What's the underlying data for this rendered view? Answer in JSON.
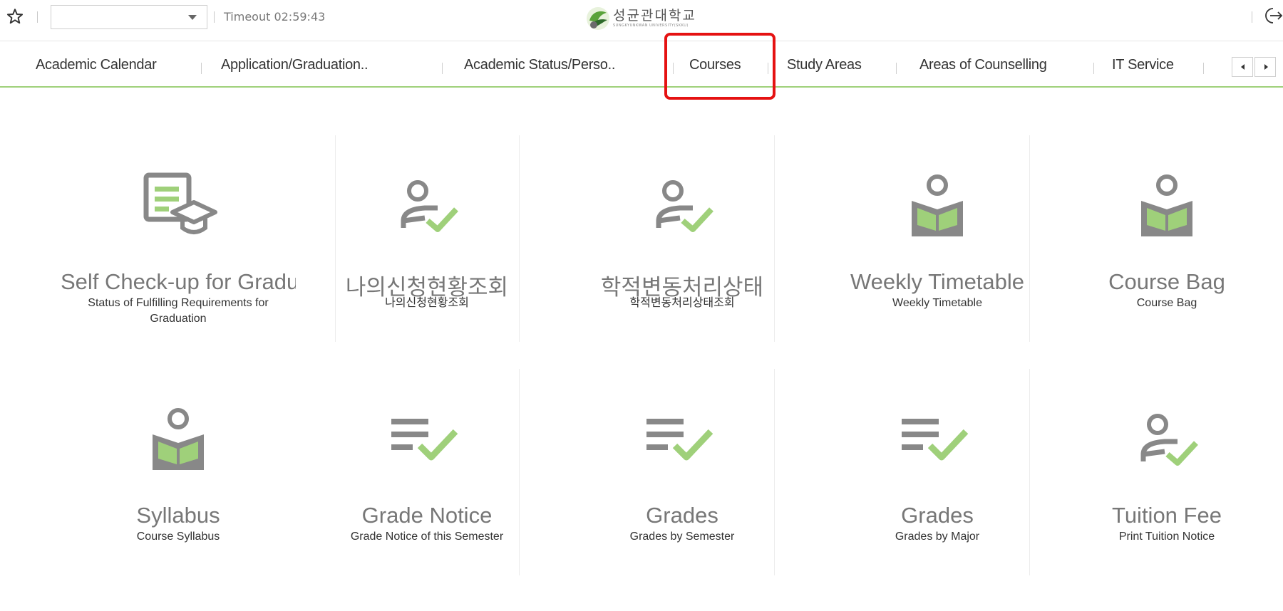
{
  "topbar": {
    "timeout_label": "Timeout 02:59:43",
    "select_value": "",
    "logo_ko": "성균관대학교",
    "logo_en": "SUNGKYUNKWAN UNIVERSITY(SKKU)"
  },
  "nav": {
    "items": [
      {
        "label": "Academic Calendar"
      },
      {
        "label": "Application/Graduation.."
      },
      {
        "label": "Academic Status/Perso.."
      },
      {
        "label": "Courses"
      },
      {
        "label": "Study Areas"
      },
      {
        "label": "Areas of Counselling"
      },
      {
        "label": "IT Service"
      }
    ],
    "highlighted_item": "Courses",
    "highlight_color": "#e51212",
    "accent_color": "#9fd07a"
  },
  "tiles": [
    {
      "icon": "document-graduation-cap-icon",
      "title": "Self Check-up for Graduation",
      "subtitle": "Status of Fulfilling Requirements for Graduation"
    },
    {
      "icon": "person-check-icon",
      "title": "나의신청현황조회",
      "subtitle": "나의신청현황조회"
    },
    {
      "icon": "person-check-icon",
      "title": "학적변동처리상태",
      "subtitle": "학적변동처리상태조회"
    },
    {
      "icon": "person-book-icon",
      "title": "Weekly Timetable",
      "subtitle": "Weekly Timetable"
    },
    {
      "icon": "person-book-icon",
      "title": "Course Bag",
      "subtitle": "Course Bag"
    },
    {
      "icon": "person-book-icon",
      "title": "Syllabus",
      "subtitle": "Course Syllabus"
    },
    {
      "icon": "list-check-icon",
      "title": "Grade Notice",
      "subtitle": "Grade Notice of this Semester"
    },
    {
      "icon": "list-check-icon",
      "title": "Grades",
      "subtitle": "Grades by Semester"
    },
    {
      "icon": "list-check-icon",
      "title": "Grades",
      "subtitle": "Grades by Major"
    },
    {
      "icon": "person-check-icon",
      "title": "Tuition Fee",
      "subtitle": "Print Tuition Notice"
    }
  ],
  "colors": {
    "icon_gray": "#888888",
    "icon_green": "#9fd07a"
  }
}
